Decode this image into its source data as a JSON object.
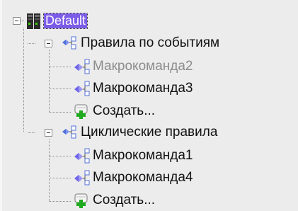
{
  "tree": {
    "root": {
      "label": "Default",
      "icon": "server-icon",
      "selected": true,
      "expanded": true
    },
    "groups": [
      {
        "label": "Правила по событиям",
        "icon": "rule-group-icon",
        "expanded": true,
        "items": [
          {
            "label": "Макрокоманда2",
            "icon": "macro-icon",
            "disabled": true
          },
          {
            "label": "Макрокоманда3",
            "icon": "macro-icon",
            "disabled": false
          },
          {
            "label": "Создать...",
            "icon": "create-new-icon",
            "disabled": false
          }
        ]
      },
      {
        "label": "Циклические правила",
        "icon": "rule-group-icon",
        "expanded": true,
        "items": [
          {
            "label": "Макрокоманда1",
            "icon": "macro-icon",
            "disabled": false
          },
          {
            "label": "Макрокоманда4",
            "icon": "macro-icon",
            "disabled": false
          },
          {
            "label": "Создать...",
            "icon": "create-new-icon",
            "disabled": false
          }
        ]
      }
    ]
  },
  "colors": {
    "background": "#ececec",
    "selection": "#7b5ce8",
    "disabled_text": "#8d8d8d",
    "tree_lines": "#8a8a8a",
    "add_plus": "#1faa1f"
  }
}
